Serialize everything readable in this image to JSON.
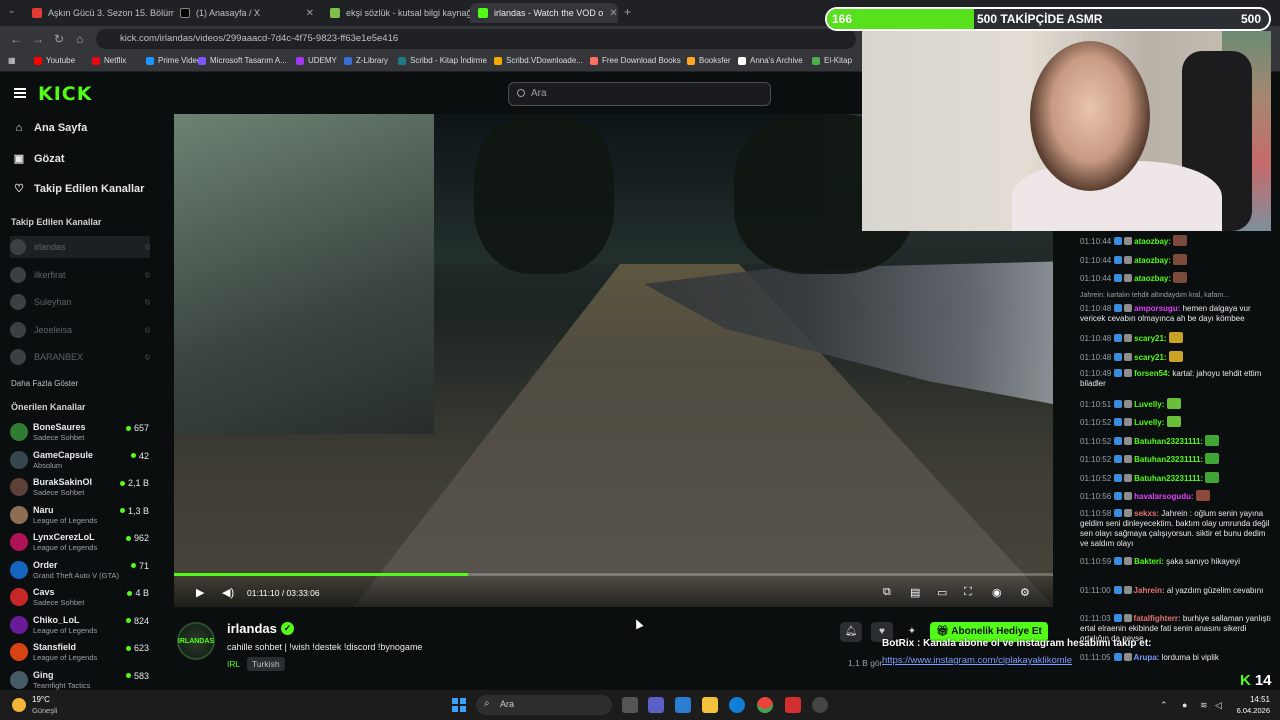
{
  "browser": {
    "tabs": [
      {
        "label": "Aşkın Gücü 3. Sezon 15. Bölüm",
        "fav_color": "#e53935"
      },
      {
        "label": "(1) Anasayfa / X",
        "fav_color": "#000000"
      },
      {
        "label": "ekşi sözlük - kutsal bilgi kaynağı",
        "fav_color": "#81c14b"
      },
      {
        "label": "irlandas - Watch the VOD o",
        "fav_color": "#53fc18"
      }
    ],
    "new_tab": "+",
    "url": "kick.com/irlandas/videos/299aaacd-7d4c-4f75-9823-ff63e1e5e416",
    "bookmarks": [
      {
        "label": "Youtube",
        "color": "#ff0000"
      },
      {
        "label": "Netflix",
        "color": "#e50914"
      },
      {
        "label": "Prime Video",
        "color": "#1a98ff"
      },
      {
        "label": "Microsoft Tasarım A...",
        "color": "#7f57ff"
      },
      {
        "label": "UDEMY",
        "color": "#a435f0"
      },
      {
        "label": "Z-Library",
        "color": "#3b6fd8"
      },
      {
        "label": "Scribd - Kitap İndirme",
        "color": "#1e7b85"
      },
      {
        "label": "Scribd.VDownloade...",
        "color": "#f2a900"
      },
      {
        "label": "Free Download Books",
        "color": "#ff6f61"
      },
      {
        "label": "Booksfer",
        "color": "#ffa726"
      },
      {
        "label": "Anna's Archive",
        "color": "#ffffff"
      },
      {
        "label": "El-Kitap",
        "color": "#4caf50"
      }
    ]
  },
  "kick": {
    "logo": "KICK",
    "search_placeholder": "Ara",
    "nav": [
      {
        "label": "Ana Sayfa",
        "icon": "home-icon",
        "glyph": "⌂"
      },
      {
        "label": "Gözat",
        "icon": "browse-icon",
        "glyph": "▣"
      },
      {
        "label": "Takip Edilen Kanallar",
        "icon": "heart-icon",
        "glyph": "♡"
      }
    ],
    "followed_title": "Takip Edilen Kanallar",
    "followed": [
      "irlandas",
      "ilkerfirat",
      "Suleyhan",
      "Jeoeleisa",
      "BARANBEX"
    ],
    "show_more": "Daha Fazla Göster",
    "recommended_title": "Önerilen Kanallar",
    "recommended": [
      {
        "name": "BoneSaures",
        "category": "Sadece Sohbet",
        "viewers": "657",
        "color": "#2e7d32"
      },
      {
        "name": "GameCapsule",
        "category": "Absolum",
        "viewers": "42",
        "color": "#37474f"
      },
      {
        "name": "BurakSakinOl",
        "category": "Sadece Sohbet",
        "viewers": "2,1 B",
        "color": "#5d4037"
      },
      {
        "name": "Naru",
        "category": "League of Legends",
        "viewers": "1,3 B",
        "color": "#8e6e53"
      },
      {
        "name": "LynxCerezLoL",
        "category": "League of Legends",
        "viewers": "962",
        "color": "#ad1457"
      },
      {
        "name": "Order",
        "category": "Grand Theft Auto V (GTA)",
        "viewers": "71",
        "color": "#1565c0"
      },
      {
        "name": "Cavs",
        "category": "Sadece Sohbet",
        "viewers": "4 B",
        "color": "#c62828"
      },
      {
        "name": "Chiko_LoL",
        "category": "League of Legends",
        "viewers": "824",
        "color": "#6a1b9a"
      },
      {
        "name": "Stansfield",
        "category": "League of Legends",
        "viewers": "623",
        "color": "#d84315"
      },
      {
        "name": "Ging",
        "category": "Teamfight Tactics",
        "viewers": "583",
        "color": "#455a64"
      }
    ]
  },
  "player": {
    "time": "01:11:10 / 03:33:06",
    "progress": 0.334
  },
  "stream": {
    "streamer": "irlandas",
    "avatar_text": "IRLANDAS",
    "title": "cahille sohbet | !wish !destek !discord !bynogame",
    "category": "IRL",
    "language": "Turkish",
    "subscribe_gift": "Abonelik Hediye Et",
    "viewers": "1,1 B gör"
  },
  "overlay": {
    "goal_current": "166",
    "goal_label": "500 TAKİPÇİDE ASMR",
    "goal_target": "500",
    "goal_progress": 0.332,
    "botrix": "BotRix : Kanala abone ol ve instagram hesabımı takip et:",
    "botrix_link": "https://www.instagram.com/ciplakayaklikomle",
    "kick_count": "14"
  },
  "chat": [
    {
      "ts": "01:10:44",
      "user": "ataozbay:",
      "color": "#53fc18",
      "text": "",
      "emote": "#7a4b3a"
    },
    {
      "ts": "01:10:44",
      "user": "ataozbay:",
      "color": "#53fc18",
      "text": "",
      "emote": "#7a4b3a"
    },
    {
      "ts": "01:10:44",
      "user": "ataozbay:",
      "color": "#53fc18",
      "text": "",
      "emote": "#7a4b3a"
    },
    {
      "sys": true,
      "text": "Jahrein: kartalın tehdit altındaydım kral, kafam..."
    },
    {
      "ts": "01:10:48",
      "user": "amporsugu:",
      "color": "#e040fb",
      "text": "hemen dalgaya vur vericek cevabın olmayınca ah be dayı kömbee"
    },
    {
      "ts": "01:10:48",
      "user": "scary21:",
      "color": "#53fc18",
      "text": "",
      "emote": "#c9a227"
    },
    {
      "ts": "01:10:48",
      "user": "scary21:",
      "color": "#53fc18",
      "text": "",
      "emote": "#c9a227"
    },
    {
      "ts": "01:10:49",
      "user": "forsen54:",
      "color": "#53fc18",
      "text": "kartal: jahoyu tehdit ettim biladler"
    },
    {
      "ts": "01:10:51",
      "user": "Luvelly:",
      "color": "#53fc18",
      "text": "",
      "emote": "#6abf3a"
    },
    {
      "ts": "01:10:52",
      "user": "Luvelly:",
      "color": "#53fc18",
      "text": "",
      "emote": "#6abf3a"
    },
    {
      "ts": "01:10:52",
      "user": "Batuhan23231111:",
      "color": "#53fc18",
      "text": "",
      "emote": "#3fa535"
    },
    {
      "ts": "01:10:52",
      "user": "Batuhan23231111:",
      "color": "#53fc18",
      "text": "",
      "emote": "#3fa535"
    },
    {
      "ts": "01:10:52",
      "user": "Batuhan23231111:",
      "color": "#53fc18",
      "text": "",
      "emote": "#3fa535"
    },
    {
      "ts": "01:10:56",
      "user": "havalarsogudu:",
      "color": "#e040fb",
      "text": "",
      "emote": "#8d4a3a"
    },
    {
      "ts": "01:10:58",
      "user": "sekxs:",
      "color": "#e57373",
      "text": "Jahrein : oğlum senin yayına geldim seni dinleyecektim. baktım olay umrunda değil sen olayı sağmaya çalışıyorsun. siktir et bunu dedim ve saldım olayı"
    },
    {
      "ts": "01:10:59",
      "user": "Bakteri:",
      "color": "#53fc18",
      "text": "şaka sanıyo hikayeyi"
    },
    {
      "ts": "01:11:00",
      "user": "Jahrein:",
      "color": "#e57373",
      "text": "al yazdım güzelim cevabını"
    },
    {
      "ts": "01:11:03",
      "user": "fatalfighterr:",
      "color": "#e57373",
      "text": "burhiye sallaman yanlıştı ertal elraenin ekibinde fati senin anasını sikerdi ortalığın da neyse"
    },
    {
      "ts": "01:11:05",
      "user": "Arupa:",
      "color": "#7c9cff",
      "text": "lorduma bi viplik"
    }
  ],
  "taskbar": {
    "temp": "19°C",
    "weather": "Güneşli",
    "search": "Ara",
    "time": "14:51",
    "date": "6.04.2026"
  }
}
